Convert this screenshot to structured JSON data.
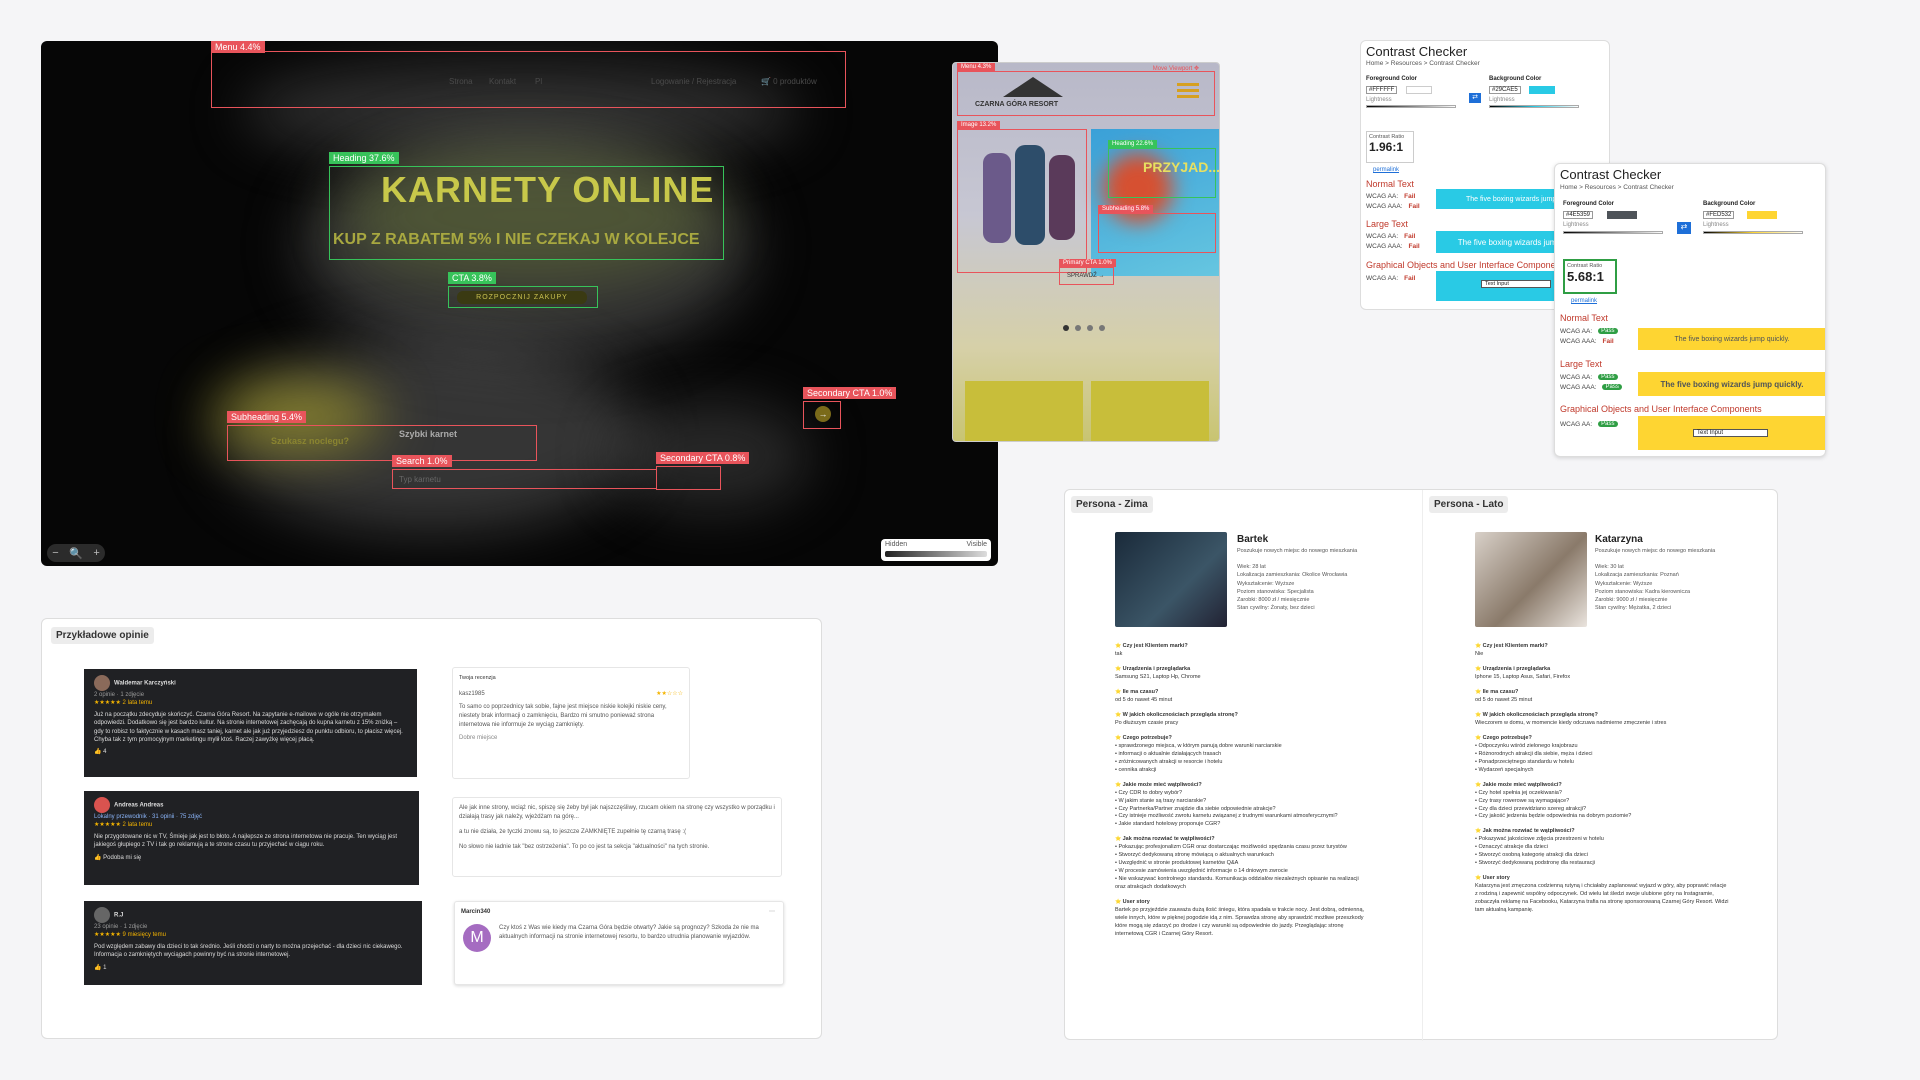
{
  "heatmap": {
    "nav_items": [
      "Strona",
      "Kontakt",
      "Pl"
    ],
    "login": "Logowanie / Rejestracja",
    "cart": "🛒 0 produktów",
    "title": "KARNETY ONLINE",
    "subtitle": "KUP Z RABATEM 5% I NIE CZEKAJ W KOLEJCE",
    "cta_button": "ROZPOCZNIJ ZAKUPY",
    "box1_title": "Szukasz noclegu?",
    "box2_title": "Szybki karnet",
    "search_placeholder": "Typ karnetu",
    "tags": {
      "menu": "Menu 4.4%",
      "heading": "Heading 37.6%",
      "cta": "CTA 3.8%",
      "subheading": "Subheading 5.4%",
      "search": "Search 1.0%",
      "secondary_cta_1": "Secondary CTA 1.0%",
      "secondary_cta_2": "Secondary CTA 0.8%"
    },
    "zoom": {
      "minus": "−",
      "icon": "🔍",
      "plus": "+"
    },
    "visibility": {
      "hidden": "Hidden",
      "visible": "Visible"
    }
  },
  "mobile": {
    "brand": "CZARNA GÓRA RESORT",
    "move_viewport": "Move Viewport ✥",
    "tags": {
      "menu": "Menu 4.3%",
      "image": "Image 13.2%",
      "heading": "Heading 22.6%",
      "subheading": "Subheading 5.8%",
      "primary_cta": "Primary CTA 1.0%"
    },
    "heading_text": "PRZYJAD...",
    "cta": "SPRAWDŹ →"
  },
  "contrast1": {
    "title": "Contrast Checker",
    "crumb": "Home > Resources > Contrast Checker",
    "fg_label": "Foreground Color",
    "fg_hex": "#FFFFFF",
    "bg_label": "Background Color",
    "bg_hex": "#29CAE5",
    "lightness": "Lightness",
    "ratio_label": "Contrast Ratio",
    "ratio": "1.96:1",
    "permalink": "permalink",
    "normal": "Normal Text",
    "large": "Large Text",
    "graphical": "Graphical Objects and User Interface Components",
    "aa": "WCAG AA:",
    "aaa": "WCAG AAA:",
    "fail": "Fail",
    "sample": "The five boxing wizards jump quickly.",
    "text_input": "Text Input"
  },
  "contrast2": {
    "title": "Contrast Checker",
    "crumb": "Home > Resources > Contrast Checker",
    "fg_label": "Foreground Color",
    "fg_hex": "#4E5359",
    "bg_label": "Background Color",
    "bg_hex": "#FED532",
    "lightness": "Lightness",
    "ratio_label": "Contrast Ratio",
    "ratio": "5.68:1",
    "permalink": "permalink",
    "normal": "Normal Text",
    "large": "Large Text",
    "graphical": "Graphical Objects and User Interface Components",
    "aa": "WCAG AA:",
    "aaa": "WCAG AAA:",
    "pass": "Pass",
    "fail": "Fail",
    "sample": "The five boxing wizards jump quickly.",
    "text_input": "Text Input"
  },
  "reviews": {
    "label": "Przykładowe opinie",
    "r1": {
      "name": "Waldemar Karczyński",
      "meta": "2 opinie · 1 zdjęcie",
      "time": "★★★★★ 2 lata temu",
      "text": "Już na początku zdecyduje skończyć. Czarna Góra Resort. Na zapytanie e-mailowe w ogóle nie otrzymałem odpowiedzi. Dodatkowo się jest bardzo kultur. Na stronie internetowej zachęcają do kupna karnetu z 15% zniżką – gdy to robisz to faktycznie w kasach masz taniej, karnet ale jak już przyjedziesz do punktu odbioru, to płacisz więcej. Chyba tak z tym promocyjnym marketingu mylił ktoś. Raczej zawyżkę więcej płacą.",
      "likes": "4"
    },
    "r2": {
      "name": "Andreas Andreas",
      "meta": "Lokalny przewodnik · 31 opinii · 75 zdjęć",
      "time": "★★★★★ 2 lata temu",
      "text": "Nie przygotowane nic w TV, Śmieje jak jest to błoto. A najlepsze ze strona internetowa nie pracuje. Ten wyciąg jest jakiegoś głupiego z TV i tak go reklamują a te strone czasu tu przyjechać w ciągu roku.",
      "likes": "Podoba mi się"
    },
    "r3": {
      "name": "R.J",
      "meta": "23 opinie · 1 zdjęcie",
      "time": "★★★★★ 9 miesięcy temu",
      "text": "Pod względem zabawy dla dzieci to tak średnio. Jeśli chodzi o narty to można przejechać - dla dzieci nic ciekawego. Informacja o zamkniętych wyciągach powinny być na stronie internetowej.",
      "likes": "1"
    },
    "l1": {
      "head": "Twoja recenzja",
      "user": "kasz1985",
      "text": "To samo co poprzednicy tak sobie, fajne jest miejsce niskie kolejki niskie ceny, niestety brak informacji o zamknięciu, Bardzo mi smutno ponieważ strona internetowa nie informuje że wyciąg zamknięty.",
      "rating": "Dobre miejsce"
    },
    "l2": {
      "text": "Ale jak inne strony, wciąż nic, spiszę się żeby był jak najszczęśliwy, rzucam okiem na stronę czy wszystko w porządku i działają trasy jak należy, wjeżdżam na górę...",
      "text2": "a tu nie działa, że tyczki znowu są, to jeszcze ZAMKNIĘTE zupełnie tę czarną trasę :(",
      "text3": "No słowo nie ładnie tak \"bez ostrzeżenia\". To po co jest ta sekcja \"aktualności\" na tych stronie."
    },
    "l3": {
      "user": "Marcin340",
      "text": "Czy ktoś z Was wie kiedy ma Czarna Góra będzie otwarty? Jakie są prognozy? Szkoda że nie ma aktualnych informacji na stronie internetowej resortu, to bardzo utrudnia planowanie wyjazdów.",
      "avatar": "M"
    }
  },
  "personas": {
    "winter": {
      "label": "Persona - Zima",
      "name": "Bartek",
      "desc": "Poszukuje nowych miejsc do nowego mieszkania",
      "facts": "Wiek: 28 lat\nLokalizacja zamieszkania: Okolice Wrocławia\nWykształcenie: Wyższe\nPoziom stanowiska: Specjalista\nZarobki: 8000 zł / miesięcznie\nStan cywilny: Żonaty, bez dzieci",
      "qa": [
        [
          "Czy jest Klientem marki?",
          "tak"
        ],
        [
          "Urządzenia i przeglądarka",
          "Samsung S21, Laptop Hp, Chrome"
        ],
        [
          "Ile ma czasu?",
          "od 5 do nawet 45 minut"
        ],
        [
          "W jakich okolicznościach przegląda stronę?",
          "Po dłuższym czasie pracy"
        ],
        [
          "Czego potrzebuje?",
          "• sprawdzonego miejsca, w którym panują dobre warunki narciarskie\n• informacji o aktualnie działających trasach\n• zróżnicowanych atrakcji w resorcie i hotelu\n• cennika atrakcji"
        ],
        [
          "Jakie może mieć wątpliwości?",
          "• Czy CDR to dobry wybór?\n• W jakim stanie są trasy narciarskie?\n• Czy Partnerka/Partner znajdzie dla siebie odpowiednie atrakcje?\n• Czy istnieje możliwość zwrotu karnetu związanej z trudnymi warunkami atmosferycznymi?\n• Jakie standard hotelowy proponuje CGR?"
        ],
        [
          "Jak można rozwiać te wątpliwości?",
          "• Pokazując profesjonalizm CGR oraz dostarczając możliwości spędzania czasu przez turystów\n• Stworzyć dedykowaną stronę mówiącą o aktualnych warunkach\n• Uwzględnić w stronie produktowej karnetów Q&A\n• W procesie zamówienia uwzględnić informacje o 14 dniowym zwrocie\n• Nie wskazywać kontrolnego standardu. Komunikacja oddziałów niezależnych opisanie na realizacji oraz atrakcjach dodatkowych"
        ],
        [
          "User story",
          "Bartek po przyjeździe zauważa dużą ilość śniegu, która spadała w trakcie nocy. Jest dobrą, odmienną, wiele innych, które w pięknej pogodzie idą z nim. Sprawdza stronę aby sprawdzić możliwe przeszkody które mogą się zdarzyć po drodze i czy warunki są odpowiednie do jazdy. Przeglądając stronę internetową CGR i Czarnej Góry Resort."
        ]
      ]
    },
    "summer": {
      "label": "Persona - Lato",
      "name": "Katarzyna",
      "desc": "Poszukuje nowych miejsc do nowego mieszkania",
      "facts": "Wiek: 30 lat\nLokalizacja zamieszkania: Poznań\nWykształcenie: Wyższe\nPoziom stanowiska: Kadra kierownicza\nZarobki: 9000 zł / miesięcznie\nStan cywilny: Mężatka, 2 dzieci",
      "qa": [
        [
          "Czy jest Klientem marki?",
          "Nie"
        ],
        [
          "Urządzenia i przeglądarka",
          "Iphone 15, Laptop Asus, Safari, Firefox"
        ],
        [
          "Ile ma czasu?",
          "od 5 do nawet 25 minut"
        ],
        [
          "W jakich okolicznościach przegląda stronę?",
          "Wieczorem w domu, w momencie kiedy odczuwa nadmierne zmęczenie i stres"
        ],
        [
          "Czego potrzebuje?",
          "• Odpoczynku wśród zielonego krajobrazu\n• Różnorodnych atrakcji dla siebie, męża i dzieci\n• Ponadprzeciętnego standardu w hotelu\n• Wydarzeń specjalnych"
        ],
        [
          "Jakie może mieć wątpliwości?",
          "• Czy hotel spełnia jej oczekiwania?\n• Czy trasy rowerowe są wymagające?\n• Czy dla dzieci przewidziano szereg atrakcji?\n• Czy jakość jedzenia będzie odpowiednia na dobrym poziomie?"
        ],
        [
          "Jak można rozwiać te wątpliwości?",
          "• Pokazywać jakościowe zdjęcia przestrzeni w hotelu\n• Oznaczyć atrakcje dla dzieci\n• Stworzyć osobną kategorię atrakcji dla dzieci\n• Stworzyć dedykowaną podstronę dla restauracji"
        ],
        [
          "User story",
          "Katarzyna jest zmęczona codzienną rutyną i chciałaby zaplanować wyjazd w góry, aby poprawić relacje z rodziną i zapewnić wspólny odpoczynek. Od wielu lat śledzi swoje ulubione góry na Instagramie, zobaczyła reklamę na Facebooku, Katarzyna trafia na stronę sponsorowaną Czarnej Góry Resort. Widzi tam aktualną kampanię."
        ]
      ]
    }
  }
}
